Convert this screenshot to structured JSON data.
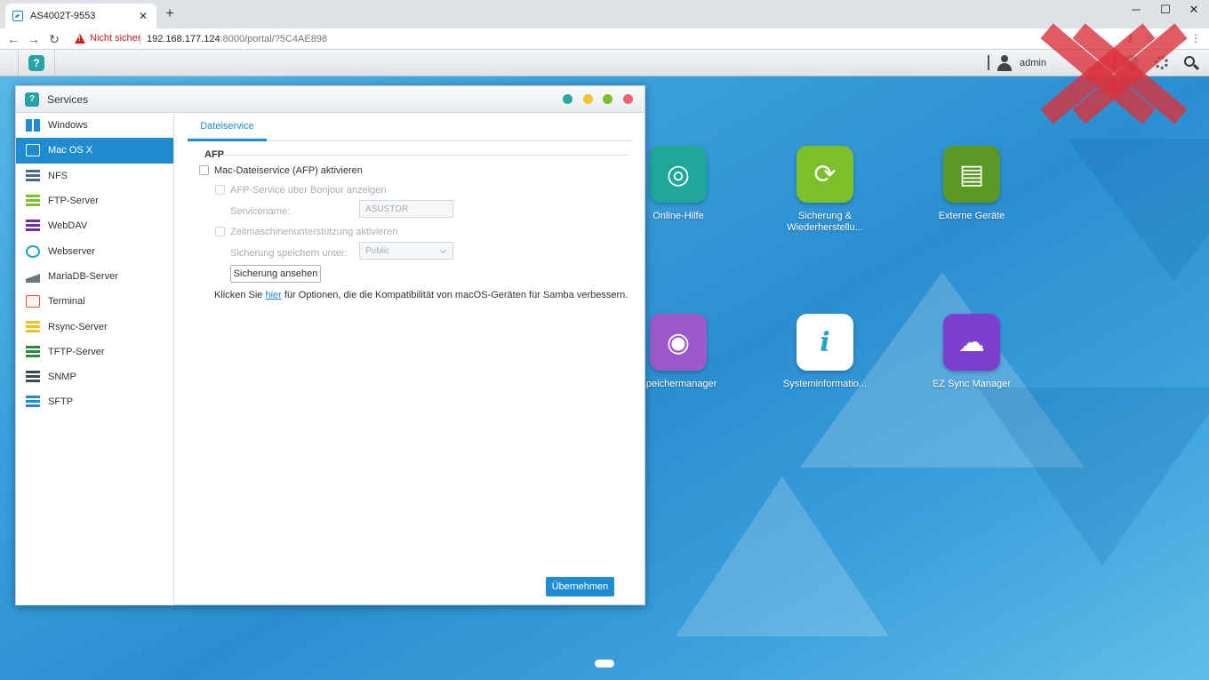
{
  "browser": {
    "tab_title": "AS4002T-9553",
    "tab_close": "✕",
    "new_tab": "+",
    "win_minimize": "─",
    "win_maximize": "☐",
    "win_close": "✕",
    "back": "←",
    "forward": "→",
    "reload": "↻",
    "security_text": "Nicht sicher",
    "url_host": "192.168.177.124",
    "url_rest": ":8000/portal/?5C4AE898",
    "key_icon": "⚷",
    "star_icon": "☆",
    "menu_icon": "⋮"
  },
  "taskbar": {
    "app_glyph": "?",
    "user_name": "admin"
  },
  "desktop_apps": [
    {
      "label": "Online-Hilfe",
      "color": "#1fa899",
      "glyph": "◎"
    },
    {
      "label": "Sicherung & Wiederherstellu...",
      "color": "#7cbf2a",
      "glyph": "⟳"
    },
    {
      "label": "Externe Geräte",
      "color": "#5a9a24",
      "glyph": "▤"
    },
    {
      "label": "Speichermanager",
      "color": "#9b59c9",
      "glyph": "◉"
    },
    {
      "label": "Systeminformatio...",
      "color": "#ffffff",
      "glyph": "i"
    },
    {
      "label": "EZ Sync Manager",
      "color": "#7b3fd0",
      "glyph": "☁"
    }
  ],
  "window": {
    "title": "Services",
    "app_glyph": "?",
    "dot_colors": [
      "#2aa5a1",
      "#f5c232",
      "#7cbf2a",
      "#e9656a"
    ]
  },
  "sidebar": {
    "items": [
      {
        "label": "Windows",
        "icon": "windows-icon"
      },
      {
        "label": "Mac OS X",
        "icon": "finder-icon"
      },
      {
        "label": "NFS",
        "icon": "nfs-icon"
      },
      {
        "label": "FTP-Server",
        "icon": "ftp-icon"
      },
      {
        "label": "WebDAV",
        "icon": "webdav-icon"
      },
      {
        "label": "Webserver",
        "icon": "webserver-icon"
      },
      {
        "label": "MariaDB-Server",
        "icon": "mariadb-icon"
      },
      {
        "label": "Terminal",
        "icon": "terminal-icon"
      },
      {
        "label": "Rsync-Server",
        "icon": "rsync-icon"
      },
      {
        "label": "TFTP-Server",
        "icon": "tftp-icon"
      },
      {
        "label": "SNMP",
        "icon": "snmp-icon"
      },
      {
        "label": "SFTP",
        "icon": "sftp-icon"
      }
    ],
    "active_index": 1
  },
  "content": {
    "tab_label": "Dateiservice",
    "section_title": "AFP",
    "afp_enable_label": "Mac-Dateiservice (AFP) aktivieren",
    "bonjour_label": "AFP-Service über Bonjour anzeigen",
    "servicename_label": "Servicename:",
    "servicename_value": "ASUSTOR",
    "timemachine_label": "Zeitmaschinenunterstützung aktivieren",
    "backup_location_label": "Sicherung speichern unter:",
    "backup_location_value": "Public",
    "view_backup_button": "Sicherung ansehen",
    "note_prefix": "Klicken Sie ",
    "note_link": "hier",
    "note_suffix": " für Optionen, die die Kompatibilität von macOS-Geräten für Samba verbessern.",
    "apply_button": "Übernehmen"
  }
}
